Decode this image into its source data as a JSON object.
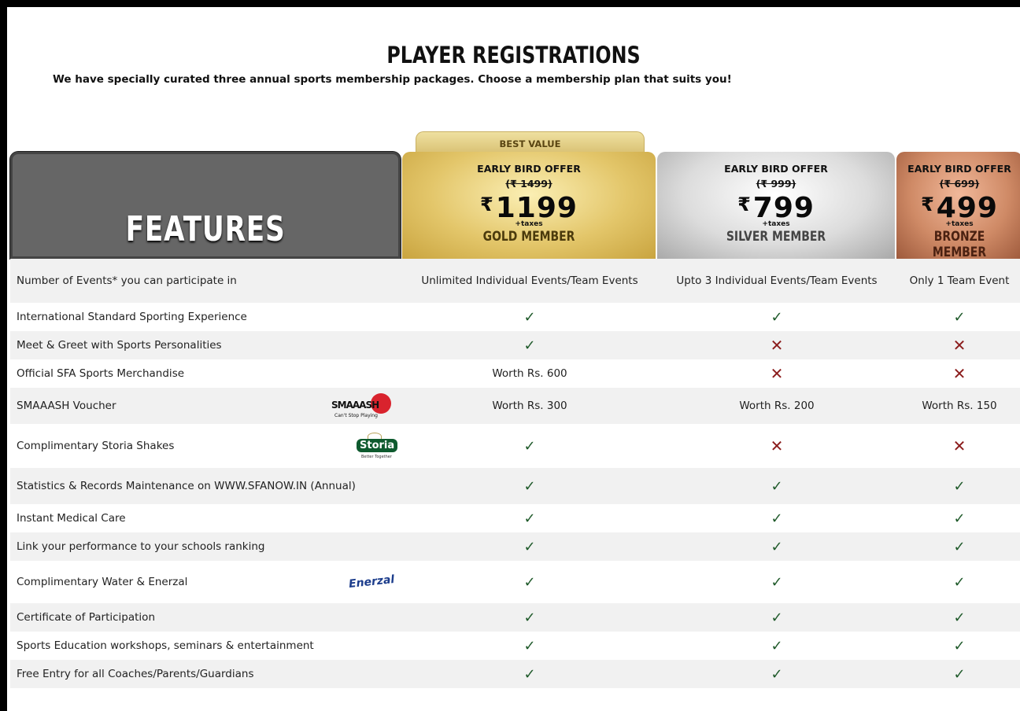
{
  "header": {
    "title": "PLAYER REGISTRATIONS",
    "subtitle": "We have specially curated three annual sports membership packages. Choose a membership plan that suits you!"
  },
  "best_value_label": "BEST VALUE",
  "features_heading": "FEATURES",
  "plans": [
    {
      "offer": "EARLY BIRD OFFER",
      "old_price": "(₹ 1499)",
      "currency": "₹",
      "price": "1199",
      "tax": "+taxes",
      "tier": "GOLD MEMBER"
    },
    {
      "offer": "EARLY BIRD OFFER",
      "old_price": "(₹ 999)",
      "currency": "₹",
      "price": "799",
      "tax": "+taxes",
      "tier": "SILVER MEMBER"
    },
    {
      "offer": "EARLY BIRD OFFER",
      "old_price": "(₹ 699)",
      "currency": "₹",
      "price": "499",
      "tax": "+taxes",
      "tier": "BRONZE MEMBER"
    }
  ],
  "logos": {
    "smaaash": {
      "word": "SMAAASH",
      "tag": "Can't Stop Playing"
    },
    "storia": {
      "word": "Storia",
      "tag": "Better Together"
    },
    "enerzal": {
      "word": "Enerzal"
    }
  },
  "icons": {
    "tick": "✓",
    "cross": "✕"
  },
  "colors": {
    "tick": "#1f5a2a",
    "cross": "#8b1c1c",
    "gold": "#e3c66a",
    "silver": "#dcdcdc",
    "bronze": "#cf8a66"
  },
  "rows": [
    {
      "feature": "Number of Events* you can participate in",
      "gold": "Unlimited Individual Events/Team Events",
      "silver": "Upto 3 Individual Events/Team Events",
      "bronze": "Only 1 Team Event"
    },
    {
      "feature": "International Standard Sporting Experience",
      "gold": "✓",
      "silver": "✓",
      "bronze": "✓"
    },
    {
      "feature": "Meet & Greet with Sports Personalities",
      "gold": "✓",
      "silver": "✕",
      "bronze": "✕"
    },
    {
      "feature": "Official SFA Sports Merchandise",
      "gold": "Worth Rs. 600",
      "silver": "✕",
      "bronze": "✕"
    },
    {
      "feature": "SMAAASH Voucher",
      "logo": "smaaash",
      "gold": "Worth Rs. 300",
      "silver": "Worth Rs. 200",
      "bronze": "Worth Rs. 150"
    },
    {
      "feature": "Complimentary Storia Shakes",
      "logo": "storia",
      "gold": "✓",
      "silver": "✕",
      "bronze": "✕"
    },
    {
      "feature": "Statistics & Records Maintenance on WWW.SFANOW.IN (Annual)",
      "gold": "✓",
      "silver": "✓",
      "bronze": "✓"
    },
    {
      "feature": "Instant Medical Care",
      "gold": "✓",
      "silver": "✓",
      "bronze": "✓"
    },
    {
      "feature": "Link your performance to your schools ranking",
      "gold": "✓",
      "silver": "✓",
      "bronze": "✓"
    },
    {
      "feature": "Complimentary Water & Enerzal",
      "logo": "enerzal",
      "gold": "✓",
      "silver": "✓",
      "bronze": "✓"
    },
    {
      "feature": "Certificate of Participation",
      "gold": "✓",
      "silver": "✓",
      "bronze": "✓"
    },
    {
      "feature": "Sports Education workshops, seminars & entertainment",
      "gold": "✓",
      "silver": "✓",
      "bronze": "✓"
    },
    {
      "feature": "Free Entry for all Coaches/Parents/Guardians",
      "gold": "✓",
      "silver": "✓",
      "bronze": "✓"
    }
  ]
}
